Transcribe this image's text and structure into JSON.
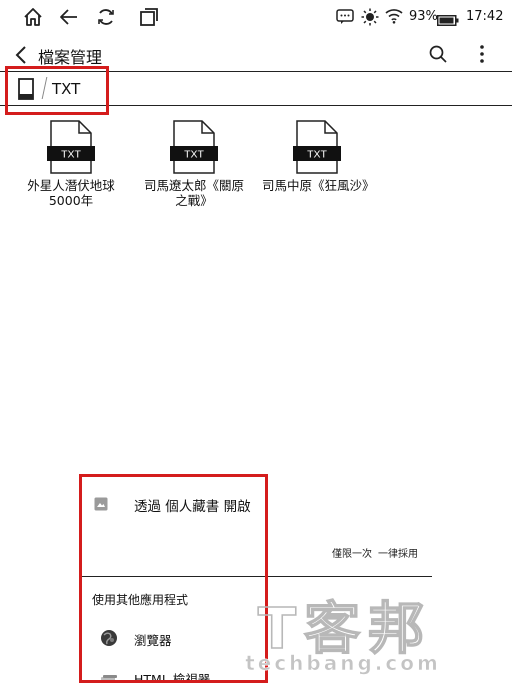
{
  "status_bar": {
    "battery": "93%",
    "time": "17:42"
  },
  "app_bar": {
    "title": "檔案管理"
  },
  "path_bar": {
    "folder": "TXT"
  },
  "files": [
    {
      "badge": "TXT",
      "name": "外星人潛伏地球5000年"
    },
    {
      "badge": "TXT",
      "name": "司馬遼太郎《關原之戰》"
    },
    {
      "badge": "TXT",
      "name": "司馬中原《狂風沙》"
    }
  ],
  "open_with_sheet": {
    "open_label": "透過 個人藏書 開啟",
    "just_once": "僅限一次",
    "always": "一律採用",
    "other_apps_title": "使用其他應用程式",
    "apps": [
      {
        "name": "瀏覽器",
        "icon": "globe-icon"
      },
      {
        "name": "HTML 檢視器",
        "icon": "html-viewer-icon"
      }
    ]
  },
  "watermark": {
    "brand": "T客邦",
    "url": "techbang.com"
  },
  "colors": {
    "highlight": "#d41c1c",
    "text": "#111111",
    "badge": "#111111"
  }
}
